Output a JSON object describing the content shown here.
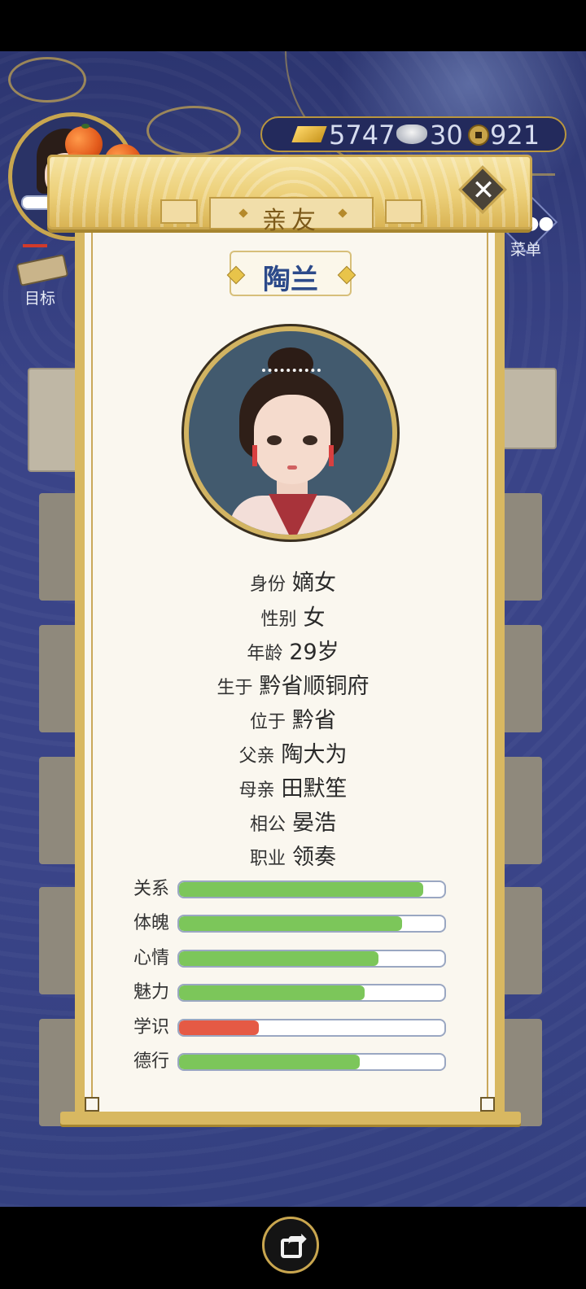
{
  "currencies": {
    "gold": "5747",
    "silver": "30",
    "coins": "921"
  },
  "side_buttons": {
    "target": "目标",
    "menu": "菜单"
  },
  "dialog": {
    "title": "亲友"
  },
  "person": {
    "name": "陶兰",
    "info": [
      {
        "label": "身份",
        "value": "嫡女"
      },
      {
        "label": "性别",
        "value": "女"
      },
      {
        "label": "年龄",
        "value": "29岁"
      },
      {
        "label": "生于",
        "value": "黔省顺铜府"
      },
      {
        "label": "位于",
        "value": "黔省"
      },
      {
        "label": "父亲",
        "value": "陶大为"
      },
      {
        "label": "母亲",
        "value": "田默笙"
      },
      {
        "label": "相公",
        "value": "晏浩"
      },
      {
        "label": "职业",
        "value": "领奏"
      }
    ],
    "stats": [
      {
        "label": "关系",
        "percent": 92,
        "color": "#7cc65a"
      },
      {
        "label": "体魄",
        "percent": 84,
        "color": "#7cc65a"
      },
      {
        "label": "心情",
        "percent": 75,
        "color": "#7cc65a"
      },
      {
        "label": "魅力",
        "percent": 70,
        "color": "#7cc65a"
      },
      {
        "label": "学识",
        "percent": 30,
        "color": "#e55a45"
      },
      {
        "label": "德行",
        "percent": 68,
        "color": "#7cc65a"
      }
    ]
  },
  "colors": {
    "accent_gold": "#c9a64f",
    "bar_green": "#7cc65a",
    "bar_red": "#e55a45"
  }
}
